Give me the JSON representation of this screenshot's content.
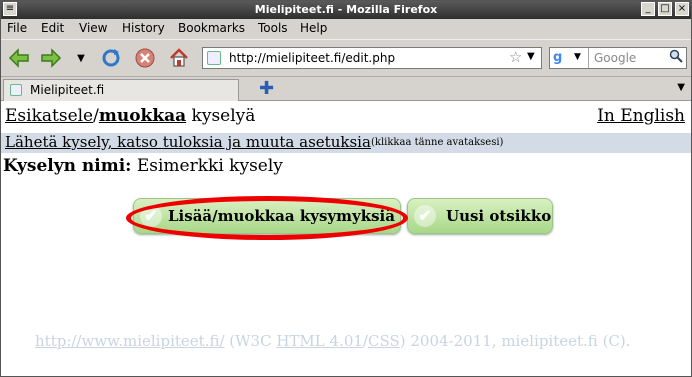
{
  "window": {
    "title": "Mielipiteet.fi - Mozilla Firefox"
  },
  "menu": [
    "File",
    "Edit",
    "View",
    "History",
    "Bookmarks",
    "Tools",
    "Help"
  ],
  "toolbar": {
    "url": "http://mielipiteet.fi/edit.php",
    "search_placeholder": "Google"
  },
  "tab": {
    "label": "Mielipiteet.fi"
  },
  "page": {
    "crumb_preview": "Esikatsele",
    "crumb_sep": "/",
    "crumb_edit": "muokkaa",
    "crumb_rest": " kyselyä",
    "lang_link": "In English",
    "settings_link": "Lähetä kysely, katso tuloksia ja muuta asetuksia",
    "settings_hint": "(klikkaa tänne avataksesi)",
    "poll_name_label": "Kyselyn nimi:",
    "poll_name_value": " Esimerkki kysely",
    "btn_questions": "Lisää/muokkaa kysymyksiä",
    "btn_new_title": "Uusi otsikko",
    "footer_link": "http://www.mielipiteet.fi/",
    "footer_w3c_open": " (W3C ",
    "footer_html": "HTML 4.01",
    "footer_slash": "/",
    "footer_css": "CSS",
    "footer_close": ") 2004-2011, mielipiteet.fi (C)."
  },
  "colors": {
    "annotation_oval": "#e00000",
    "button_green": "#a8d889",
    "settings_bar": "#d3dbe6"
  }
}
